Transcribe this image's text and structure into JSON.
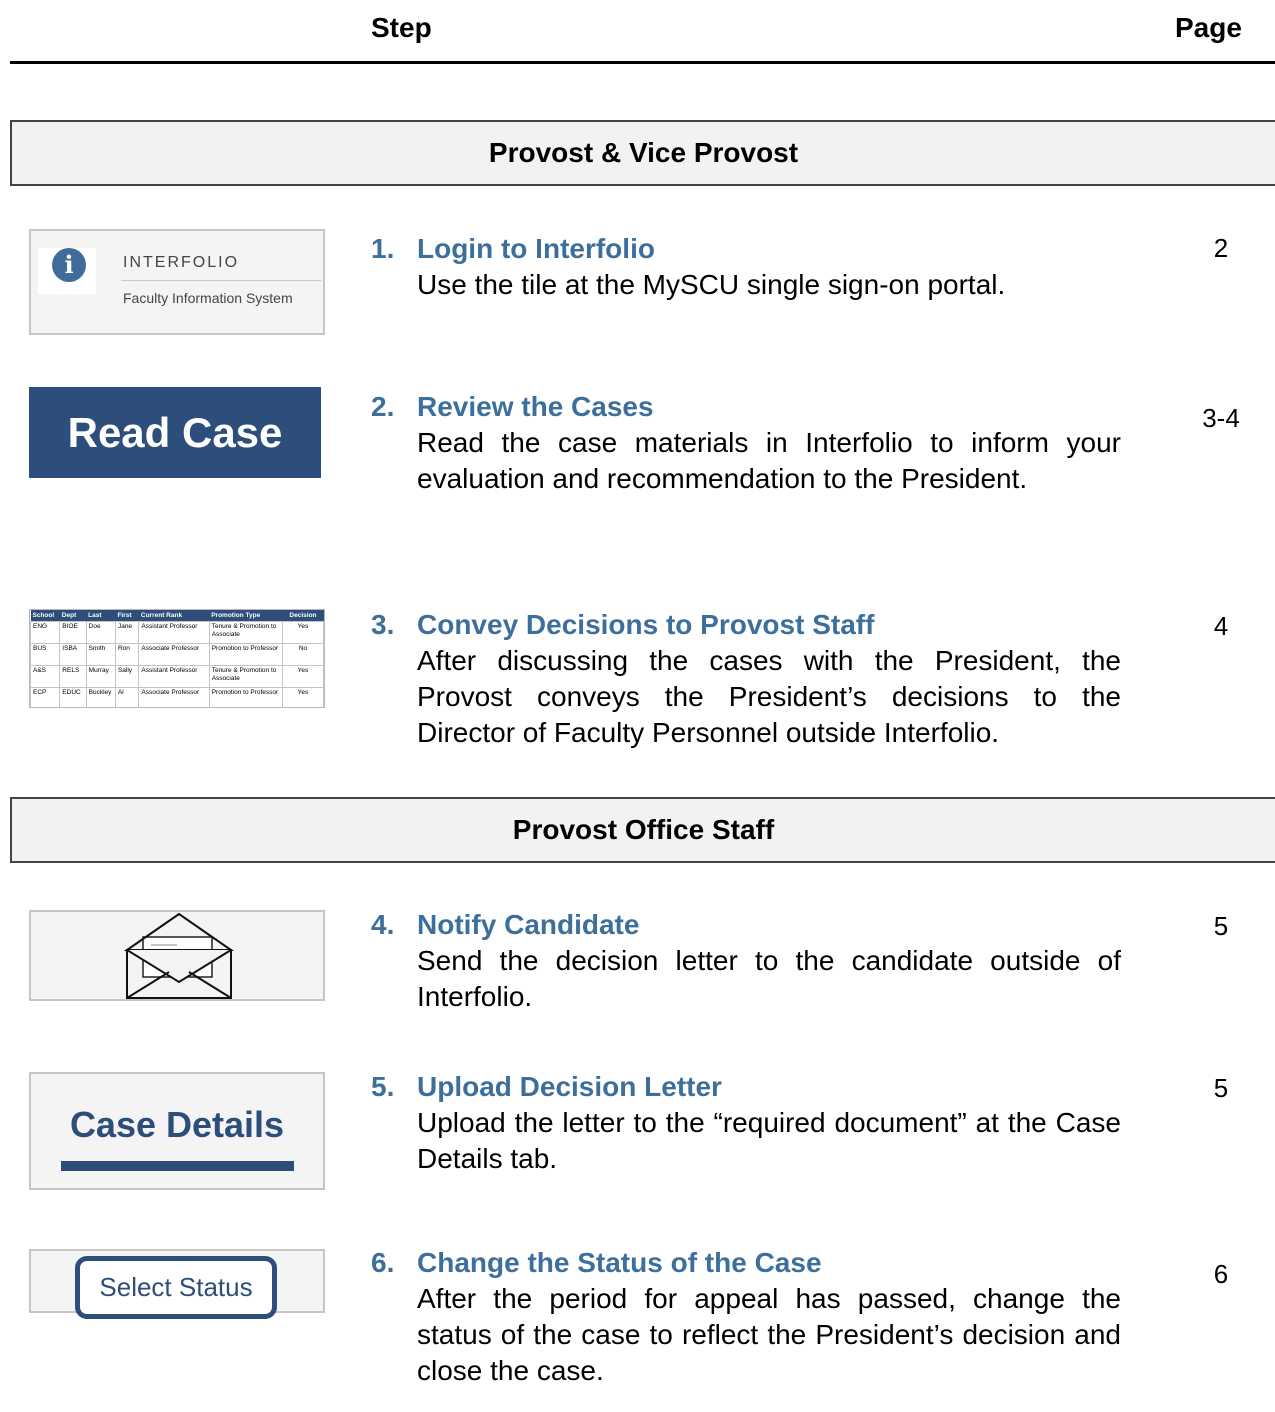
{
  "header": {
    "step_label": "Step",
    "page_label": "Page"
  },
  "sections": [
    {
      "title": "Provost & Vice Provost"
    },
    {
      "title": "Provost Office Staff"
    }
  ],
  "steps": [
    {
      "num": "1.",
      "title": "Login to Interfolio",
      "desc": "Use the tile at the MySCU single sign-on portal.",
      "page": "2"
    },
    {
      "num": "2.",
      "title": "Review the Cases",
      "desc": "Read the case materials in Interfolio to inform your evaluation and recommendation to the Pre­sident.",
      "page": "3-4"
    },
    {
      "num": "3.",
      "title": "Convey Decisions to Provost Staff",
      "desc": "After discussing the cases with the President, the Provost conveys the President’s decisions to the Director of Faculty Personnel outside Interfolio.",
      "page": "4"
    },
    {
      "num": "4.",
      "title": "Notify Candidate",
      "desc": "Send the decision letter to the candidate outside of Interfolio.",
      "page": "5"
    },
    {
      "num": "5.",
      "title": "Upload Decision Letter",
      "desc": "Upload the letter to the “required document” at the Case Details tab.",
      "page": "5"
    },
    {
      "num": "6.",
      "title": "Change the Status of the Case",
      "desc": "After the period for appeal has passed, change the status of the case to reflect the President’s decision and close the case.",
      "page": "6"
    }
  ],
  "thumbs": {
    "interfolio": {
      "brand": "INTERFOLIO",
      "sub": "Faculty Information System",
      "icon": "info-icon"
    },
    "read_case": {
      "label": "Read Case"
    },
    "table": {
      "headers": [
        "School",
        "Dept",
        "Last",
        "First",
        "Current Rank",
        "Promotion Type",
        "Decision"
      ],
      "rows": [
        [
          "ENG",
          "BIOE",
          "Doe",
          "Jane",
          "Assistant Professor",
          "Tenure & Promotion to Associate",
          "Yes"
        ],
        [
          "BUS",
          "ISBA",
          "Smith",
          "Ron",
          "Associate Professor",
          "Promotion to Professor",
          "No"
        ],
        [
          "A&S",
          "RELS",
          "Murray",
          "Sally",
          "Assistant Professor",
          "Tenure & Promotion to Associate",
          "Yes"
        ],
        [
          "ECP",
          "EDUC",
          "Buckley",
          "Al",
          "Associate Professor",
          "Promotion to Professor",
          "Yes"
        ]
      ]
    },
    "envelope": {
      "icon": "envelope-letter-icon"
    },
    "case_details": {
      "label": "Case Details"
    },
    "select_status": {
      "label": "Select Status"
    }
  },
  "colors": {
    "accent": "#3d6f9c",
    "dark_blue": "#2d4e7a",
    "band_bg": "#f2f2f2"
  }
}
